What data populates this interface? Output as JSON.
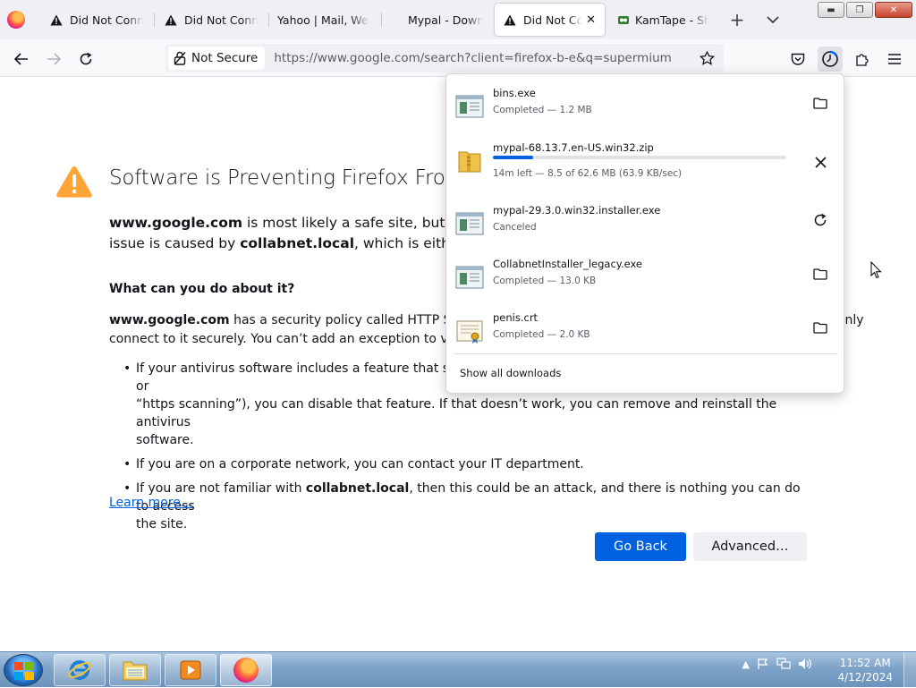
{
  "tabs": [
    {
      "label": "Did Not Connect: Potential Security Issue",
      "icon": "warning-icon",
      "active": false
    },
    {
      "label": "Did Not Connect: Potential Security Issue",
      "icon": "warning-icon",
      "active": false
    },
    {
      "label": "Yahoo | Mail, Weather, Search",
      "icon": "",
      "active": false
    },
    {
      "label": "Mypal - Downloads",
      "icon": "",
      "active": false
    },
    {
      "label": "Did Not Connect: Potential Security Issue",
      "icon": "warning-icon",
      "active": true
    },
    {
      "label": "KamTape - Share",
      "icon": "kamtape-icon",
      "active": false
    }
  ],
  "navbar": {
    "security_label": "Not Secure",
    "url": "https://www.google.com/search?client=firefox-b-e&q=supermium"
  },
  "error_page": {
    "title": "Software is Preventing Firefox From Safely Connecting to This Site",
    "intro_host": "www.google.com",
    "intro_mid": " is most likely a safe site, but a secure connection could not be established. This",
    "intro_line2_pre": "issue is caused by ",
    "intro_line2_host": "collabnet.local",
    "intro_line2_post": ", which is either software on your computer or your network.",
    "what_heading": "What can you do about it?",
    "hsts_host": "www.google.com",
    "hsts_line1": " has a security policy called HTTP Strict Transport Security (HSTS), which means that Firefox can only",
    "hsts_line2": "connect to it securely. You can’t add an exception to visit this site.",
    "tips": [
      {
        "pre": "If your antivirus software includes a feature that scans encrypted connections (often called “web scanning” or",
        "line2": "“https scanning”), you can disable that feature. If that doesn’t work, you can remove and reinstall the antivirus",
        "line3": "software."
      },
      {
        "pre": "If you are on a corporate network, you can contact your IT department."
      },
      {
        "pre": "If you are not familiar with ",
        "bold": "collabnet.local",
        "post": ", then this could be an attack, and there is nothing you can do to access",
        "line2": "the site."
      }
    ],
    "learn_more": "Learn more…",
    "go_back": "Go Back",
    "advanced": "Advanced…"
  },
  "downloads": {
    "items": [
      {
        "name": "bins.exe",
        "status": "Completed — 1.2 MB",
        "icon": "exe-file-icon",
        "action": "folder-icon"
      },
      {
        "name": "mypal-68.13.7.en-US.win32.zip",
        "status": "14m left — 8.5 of 62.6 MB (63.9 KB/sec)",
        "icon": "zip-file-icon",
        "action": "cancel-icon",
        "progress": 0.136
      },
      {
        "name": "mypal-29.3.0.win32.installer.exe",
        "status": "Canceled",
        "icon": "exe-file-icon",
        "action": "retry-icon"
      },
      {
        "name": "CollabnetInstaller_legacy.exe",
        "status": "Completed — 13.0 KB",
        "icon": "exe-file-icon",
        "action": "folder-icon"
      },
      {
        "name": "penis.crt",
        "status": "Completed — 2.0 KB",
        "icon": "certificate-file-icon",
        "action": "folder-icon"
      }
    ],
    "show_all": "Show all downloads"
  },
  "taskbar": {
    "time": "11:52 AM",
    "date": "4/12/2024"
  },
  "colors": {
    "accent": "#0061e0",
    "warning": "#ffa436"
  }
}
